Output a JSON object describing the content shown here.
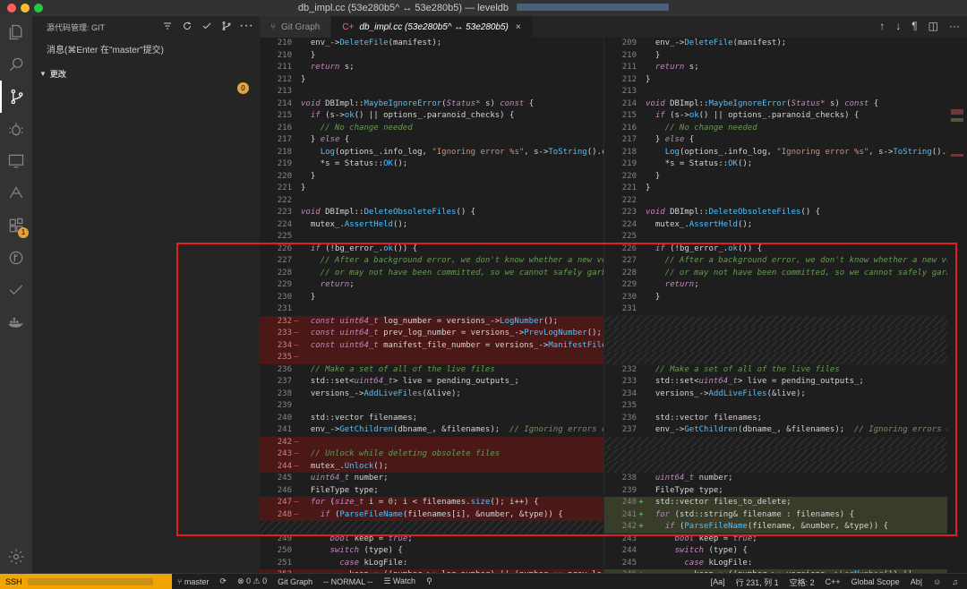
{
  "titlebar": {
    "title": "db_impl.cc (53e280b5^ ↔ 53e280b5) — leveldb"
  },
  "activity": {
    "extensions_badge": "1"
  },
  "sidebar": {
    "header": "源代码管理: GIT",
    "commit_placeholder": "消息(⌘Enter 在\"master\"提交)",
    "changes_label": "更改",
    "changes_count": "0"
  },
  "tabs": [
    {
      "label": "Git Graph",
      "icon": "git-graph-icon"
    },
    {
      "label": "db_impl.cc (53e280b5^ ↔ 53e280b5)",
      "icon": "diff-icon"
    }
  ],
  "diff": {
    "left": [
      {
        "ln": "210",
        "t": "plain",
        "c": "<span class=pl>  env_-></span><span class=fc>DeleteFile</span><span class=pl>(manifest);</span>"
      },
      {
        "ln": "210",
        "t": "plain",
        "c": "<span class=pl>  }</span>"
      },
      {
        "ln": "211",
        "t": "plain",
        "c": "<span class=pl>  </span><span class=kw>return</span><span class=pl> s;</span>"
      },
      {
        "ln": "212",
        "t": "plain",
        "c": "<span class=pl>}</span>"
      },
      {
        "ln": "213",
        "t": "plain",
        "c": ""
      },
      {
        "ln": "214",
        "t": "plain",
        "c": "<span class=ty>void</span><span class=pl> DBImpl::</span><span class=fc>MaybeIgnoreError</span><span class=pl>(</span><span class=ty>Status*</span><span class=pl> s) </span><span class=kw>const</span><span class=pl> {</span>"
      },
      {
        "ln": "215",
        "t": "plain",
        "c": "<span class=pl>  </span><span class=kw>if</span><span class=pl> (s-></span><span class=fc>ok</span><span class=pl>() || options_.paranoid_checks) {</span>"
      },
      {
        "ln": "216",
        "t": "plain",
        "c": "<span class=cm>    // No change needed</span>"
      },
      {
        "ln": "217",
        "t": "plain",
        "c": "<span class=pl>  } </span><span class=kw>else</span><span class=pl> {</span>"
      },
      {
        "ln": "218",
        "t": "plain",
        "c": "<span class=pl>    </span><span class=fc>Log</span><span class=pl>(options_.info_log, </span><span class=st>\"Ignoring error %s\"</span><span class=pl>, s-></span><span class=fc>ToString</span><span class=pl>().c</span>"
      },
      {
        "ln": "219",
        "t": "plain",
        "c": "<span class=pl>    *s = Status::</span><span class=fc>OK</span><span class=pl>();</span>"
      },
      {
        "ln": "220",
        "t": "plain",
        "c": "<span class=pl>  }</span>"
      },
      {
        "ln": "221",
        "t": "plain",
        "c": "<span class=pl>}</span>"
      },
      {
        "ln": "222",
        "t": "plain",
        "c": ""
      },
      {
        "ln": "223",
        "t": "plain",
        "c": "<span class=ty>void</span><span class=pl> DBImpl::</span><span class=fc>DeleteObsoleteFiles</span><span class=pl>() {</span>"
      },
      {
        "ln": "224",
        "t": "plain",
        "c": "<span class=pl>  mutex_.</span><span class=fc>AssertHeld</span><span class=pl>();</span>"
      },
      {
        "ln": "225",
        "t": "plain",
        "c": ""
      },
      {
        "ln": "226",
        "t": "plain",
        "c": "<span class=pl>  </span><span class=kw>if</span><span class=pl> (!bg_error_.</span><span class=fc>ok</span><span class=pl>()) {</span>"
      },
      {
        "ln": "227",
        "t": "plain",
        "c": "<span class=cm>    // After a background error, we don't know whether a new ve</span>"
      },
      {
        "ln": "228",
        "t": "plain",
        "c": "<span class=cm>    // or may not have been committed, so we cannot safely garb</span>"
      },
      {
        "ln": "229",
        "t": "plain",
        "c": "<span class=pl>    </span><span class=kw>return</span><span class=pl>;</span>"
      },
      {
        "ln": "230",
        "t": "plain",
        "c": "<span class=pl>  }</span>"
      },
      {
        "ln": "231",
        "t": "plain",
        "c": ""
      },
      {
        "ln": "232",
        "t": "del",
        "c": "<span class=pl>  </span><span class=ty>const uint64_t</span><span class=pl> log_number = versions_-></span><span class=fc>LogNumber</span><span class=pl>();</span>"
      },
      {
        "ln": "233",
        "t": "del",
        "c": "<span class=pl>  </span><span class=ty>const uint64_t</span><span class=pl> prev_log_number = versions_-></span><span class=fc>PrevLogNumber</span><span class=pl>();</span>"
      },
      {
        "ln": "234",
        "t": "del",
        "c": "<span class=pl>  </span><span class=ty>const uint64_t</span><span class=pl> manifest_file_number = versions_-></span><span class=fc>ManifestFile</span>"
      },
      {
        "ln": "235",
        "t": "del",
        "c": ""
      },
      {
        "ln": "236",
        "t": "plain",
        "c": "<span class=cm>  // Make a set of all of the live files</span>"
      },
      {
        "ln": "237",
        "t": "plain",
        "c": "<span class=pl>  std::set<</span><span class=ty>uint64_t</span><span class=pl>> live = pending_outputs_;</span>"
      },
      {
        "ln": "238",
        "t": "plain",
        "c": "<span class=pl>  versions_-></span><span class=fc>AddLiveFiles</span><span class=pl>(&live);</span>"
      },
      {
        "ln": "239",
        "t": "plain",
        "c": ""
      },
      {
        "ln": "240",
        "t": "plain",
        "c": "<span class=pl>  std::vector<std::string> filenames;</span>"
      },
      {
        "ln": "241",
        "t": "plain",
        "c": "<span class=pl>  env_-></span><span class=fc>GetChildren</span><span class=pl>(dbname_, &filenames);  </span><span class=cm>// Ignoring errors o</span>"
      },
      {
        "ln": "242",
        "t": "del",
        "c": ""
      },
      {
        "ln": "243",
        "t": "del",
        "c": "<span class=cm>  // Unlock while deleting obsolete files</span>"
      },
      {
        "ln": "244",
        "t": "del",
        "c": "<span class=pl>  mutex_.</span><span class=fc>Unlock</span><span class=pl>();</span>"
      },
      {
        "ln": "245",
        "t": "plain",
        "c": "<span class=pl>  </span><span class=ty>uint64_t</span><span class=pl> number;</span>"
      },
      {
        "ln": "246",
        "t": "plain",
        "c": "<span class=pl>  FileType type;</span>"
      },
      {
        "ln": "247",
        "t": "del",
        "c": "<span class=pl>  </span><span class=kw>for</span><span class=pl> (</span><span class=ty>size_t</span><span class=pl> i = </span><span class=nm>0</span><span class=pl>; i < filenames.</span><span class=fc>size</span><span class=pl>(); i++) {</span>"
      },
      {
        "ln": "248",
        "t": "del",
        "c": "<span class=pl>    </span><span class=kw>if</span><span class=pl> (</span><span class=fc>ParseFileName</span><span class=pl>(filenames[i], &number, &type)) {</span>"
      },
      {
        "ln": "",
        "t": "fill",
        "c": ""
      },
      {
        "ln": "249",
        "t": "plain",
        "c": "<span class=pl>      </span><span class=ty>bool</span><span class=pl> keep = </span><span class=kw>true</span><span class=pl>;</span>"
      },
      {
        "ln": "250",
        "t": "plain",
        "c": "<span class=pl>      </span><span class=kw>switch</span><span class=pl> (type) {</span>"
      },
      {
        "ln": "251",
        "t": "plain",
        "c": "<span class=pl>        </span><span class=kw>case</span><span class=pl> kLogFile:</span>"
      },
      {
        "ln": "252",
        "t": "del",
        "c": "<span class=pl>          keep = ((number >= log_number) || (number == prev_lo</span>"
      }
    ],
    "right": [
      {
        "ln": "209",
        "t": "plain",
        "c": "<span class=pl>  env_-></span><span class=fc>DeleteFile</span><span class=pl>(manifest);</span>"
      },
      {
        "ln": "210",
        "t": "plain",
        "c": "<span class=pl>  }</span>"
      },
      {
        "ln": "211",
        "t": "plain",
        "c": "<span class=pl>  </span><span class=kw>return</span><span class=pl> s;</span>"
      },
      {
        "ln": "212",
        "t": "plain",
        "c": "<span class=pl>}</span>"
      },
      {
        "ln": "213",
        "t": "plain",
        "c": ""
      },
      {
        "ln": "214",
        "t": "plain",
        "c": "<span class=ty>void</span><span class=pl> DBImpl::</span><span class=fc>MaybeIgnoreError</span><span class=pl>(</span><span class=ty>Status*</span><span class=pl> s) </span><span class=kw>const</span><span class=pl> {</span>"
      },
      {
        "ln": "215",
        "t": "plain",
        "c": "<span class=pl>  </span><span class=kw>if</span><span class=pl> (s-></span><span class=fc>ok</span><span class=pl>() || options_.paranoid_checks) {</span>"
      },
      {
        "ln": "216",
        "t": "plain",
        "c": "<span class=cm>    // No change needed</span>"
      },
      {
        "ln": "217",
        "t": "plain",
        "c": "<span class=pl>  } </span><span class=kw>else</span><span class=pl> {</span>"
      },
      {
        "ln": "218",
        "t": "plain",
        "c": "<span class=pl>    </span><span class=fc>Log</span><span class=pl>(options_.info_log, </span><span class=st>\"Ignoring error %s\"</span><span class=pl>, s-></span><span class=fc>ToString</span><span class=pl>().c</span>"
      },
      {
        "ln": "219",
        "t": "plain",
        "c": "<span class=pl>    *s = Status::</span><span class=fc>OK</span><span class=pl>();</span>"
      },
      {
        "ln": "220",
        "t": "plain",
        "c": "<span class=pl>  }</span>"
      },
      {
        "ln": "221",
        "t": "plain",
        "c": "<span class=pl>}</span>"
      },
      {
        "ln": "222",
        "t": "plain",
        "c": ""
      },
      {
        "ln": "223",
        "t": "plain",
        "c": "<span class=ty>void</span><span class=pl> DBImpl::</span><span class=fc>DeleteObsoleteFiles</span><span class=pl>() {</span>"
      },
      {
        "ln": "224",
        "t": "plain",
        "c": "<span class=pl>  mutex_.</span><span class=fc>AssertHeld</span><span class=pl>();</span>"
      },
      {
        "ln": "225",
        "t": "plain",
        "c": ""
      },
      {
        "ln": "226",
        "t": "plain",
        "c": "<span class=pl>  </span><span class=kw>if</span><span class=pl> (!bg_error_.</span><span class=fc>ok</span><span class=pl>()) {</span>"
      },
      {
        "ln": "227",
        "t": "plain",
        "c": "<span class=cm>    // After a background error, we don't know whether a new ve</span>"
      },
      {
        "ln": "228",
        "t": "plain",
        "c": "<span class=cm>    // or may not have been committed, so we cannot safely garb</span>"
      },
      {
        "ln": "229",
        "t": "plain",
        "c": "<span class=pl>    </span><span class=kw>return</span><span class=pl>;</span>"
      },
      {
        "ln": "230",
        "t": "plain",
        "c": "<span class=pl>  }</span>"
      },
      {
        "ln": "231",
        "t": "plain",
        "c": ""
      },
      {
        "ln": "",
        "t": "fill",
        "c": ""
      },
      {
        "ln": "",
        "t": "fill",
        "c": ""
      },
      {
        "ln": "",
        "t": "fill",
        "c": ""
      },
      {
        "ln": "",
        "t": "fill",
        "c": ""
      },
      {
        "ln": "232",
        "t": "plain",
        "c": "<span class=cm>  // Make a set of all of the live files</span>"
      },
      {
        "ln": "233",
        "t": "plain",
        "c": "<span class=pl>  std::set<</span><span class=ty>uint64_t</span><span class=pl>> live = pending_outputs_;</span>"
      },
      {
        "ln": "234",
        "t": "plain",
        "c": "<span class=pl>  versions_-></span><span class=fc>AddLiveFiles</span><span class=pl>(&live);</span>"
      },
      {
        "ln": "235",
        "t": "plain",
        "c": ""
      },
      {
        "ln": "236",
        "t": "plain",
        "c": "<span class=pl>  std::vector<std::string> filenames;</span>"
      },
      {
        "ln": "237",
        "t": "plain",
        "c": "<span class=pl>  env_-></span><span class=fc>GetChildren</span><span class=pl>(dbname_, &filenames);  </span><span class=cm>// Ignoring errors o</span>"
      },
      {
        "ln": "",
        "t": "fill",
        "c": ""
      },
      {
        "ln": "",
        "t": "fill",
        "c": ""
      },
      {
        "ln": "",
        "t": "fill",
        "c": ""
      },
      {
        "ln": "238",
        "t": "plain",
        "c": "<span class=pl>  </span><span class=ty>uint64_t</span><span class=pl> number;</span>"
      },
      {
        "ln": "239",
        "t": "plain",
        "c": "<span class=pl>  FileType type;</span>"
      },
      {
        "ln": "240",
        "t": "ins",
        "c": "<span class=pl>  std::vector<std::string> files_to_delete;</span>"
      },
      {
        "ln": "241",
        "t": "ins",
        "c": "<span class=pl>  </span><span class=kw>for</span><span class=pl> (std::string& filename : filenames) {</span>"
      },
      {
        "ln": "242",
        "t": "ins",
        "c": "<span class=pl>    </span><span class=kw>if</span><span class=pl> (</span><span class=fc>ParseFileName</span><span class=pl>(filename, &number, &type)) {</span>"
      },
      {
        "ln": "243",
        "t": "plain",
        "c": "<span class=pl>      </span><span class=ty>bool</span><span class=pl> keep = </span><span class=kw>true</span><span class=pl>;</span>"
      },
      {
        "ln": "244",
        "t": "plain",
        "c": "<span class=pl>      </span><span class=kw>switch</span><span class=pl> (type) {</span>"
      },
      {
        "ln": "245",
        "t": "plain",
        "c": "<span class=pl>        </span><span class=kw>case</span><span class=pl> kLogFile:</span>"
      },
      {
        "ln": "246",
        "t": "ins",
        "c": "<span class=pl>          keep = ((number >= versions_-></span><span class=fc>LogNumber</span><span class=pl>()) ||</span>"
      }
    ]
  },
  "statusbar": {
    "remote": "SSH",
    "branch": "master",
    "errors": "0",
    "warnings": "0",
    "git_graph": "Git Graph",
    "vim_mode": "-- NORMAL --",
    "watch": "Watch",
    "regex": "[Aa]",
    "position": "行 231, 列 1",
    "spaces": "空格: 2",
    "language": "C++",
    "scope": "Global Scope",
    "ab": "Ab|"
  }
}
